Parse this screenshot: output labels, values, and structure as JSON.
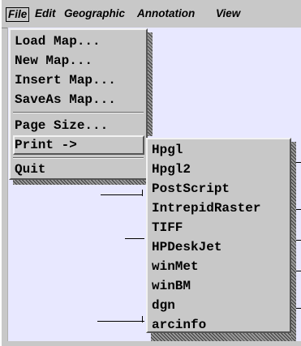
{
  "menubar": {
    "items": [
      {
        "label": "File"
      },
      {
        "label": "Edit"
      },
      {
        "label": "Geographic"
      },
      {
        "label": "Annotation"
      },
      {
        "label": "View"
      }
    ]
  },
  "file_menu": {
    "items": [
      {
        "label": "Load Map..."
      },
      {
        "label": "New Map..."
      },
      {
        "label": "Insert Map..."
      },
      {
        "label": "SaveAs Map..."
      },
      {
        "label": "Page Size..."
      },
      {
        "label": "Print ->"
      },
      {
        "label": "Quit"
      }
    ]
  },
  "print_submenu": {
    "items": [
      {
        "label": "Hpgl"
      },
      {
        "label": "Hpgl2"
      },
      {
        "label": "PostScript"
      },
      {
        "label": "IntrepidRaster"
      },
      {
        "label": "TIFF"
      },
      {
        "label": "HPDeskJet"
      },
      {
        "label": "winMet"
      },
      {
        "label": "winBM"
      },
      {
        "label": "dgn"
      },
      {
        "label": "arcinfo"
      }
    ]
  },
  "colors": {
    "menu_bg": "#c8c8c8",
    "canvas_bg": "#e8e8ff",
    "text": "#000000"
  }
}
